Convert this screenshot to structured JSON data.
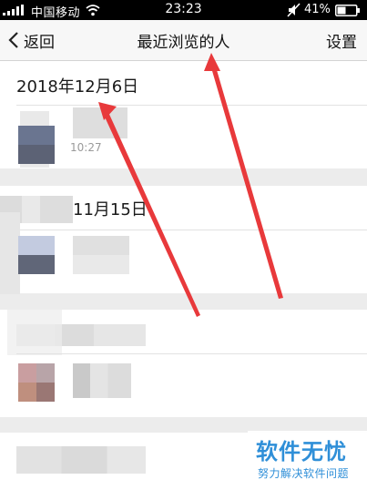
{
  "status_bar": {
    "carrier": "中国移动",
    "time": "23:23",
    "battery_percent": "41%",
    "signal-icon": "signal-bars-icon",
    "wifi-icon": "wifi-icon",
    "mute-icon": "mute-icon",
    "battery-icon": "battery-icon"
  },
  "nav": {
    "back_label": "返回",
    "title": "最近浏览的人",
    "settings_label": "设置",
    "back_icon": "chevron-left-icon"
  },
  "sections": [
    {
      "date": "2018年12月6日",
      "visitors": [
        {
          "time": "10:27"
        }
      ]
    },
    {
      "date": "11月15日",
      "visitors": [
        {}
      ]
    },
    {
      "date": "",
      "visitors": [
        {}
      ]
    },
    {
      "date": "",
      "visitors": []
    }
  ],
  "watermark": {
    "title": "软件无忧",
    "subtitle": "努力解决软件问题"
  },
  "colors": {
    "accent_arrow": "#e8393b",
    "watermark_blue": "#2f8fd8",
    "nav_bg": "#f7f7f7",
    "page_bg": "#ececec"
  }
}
